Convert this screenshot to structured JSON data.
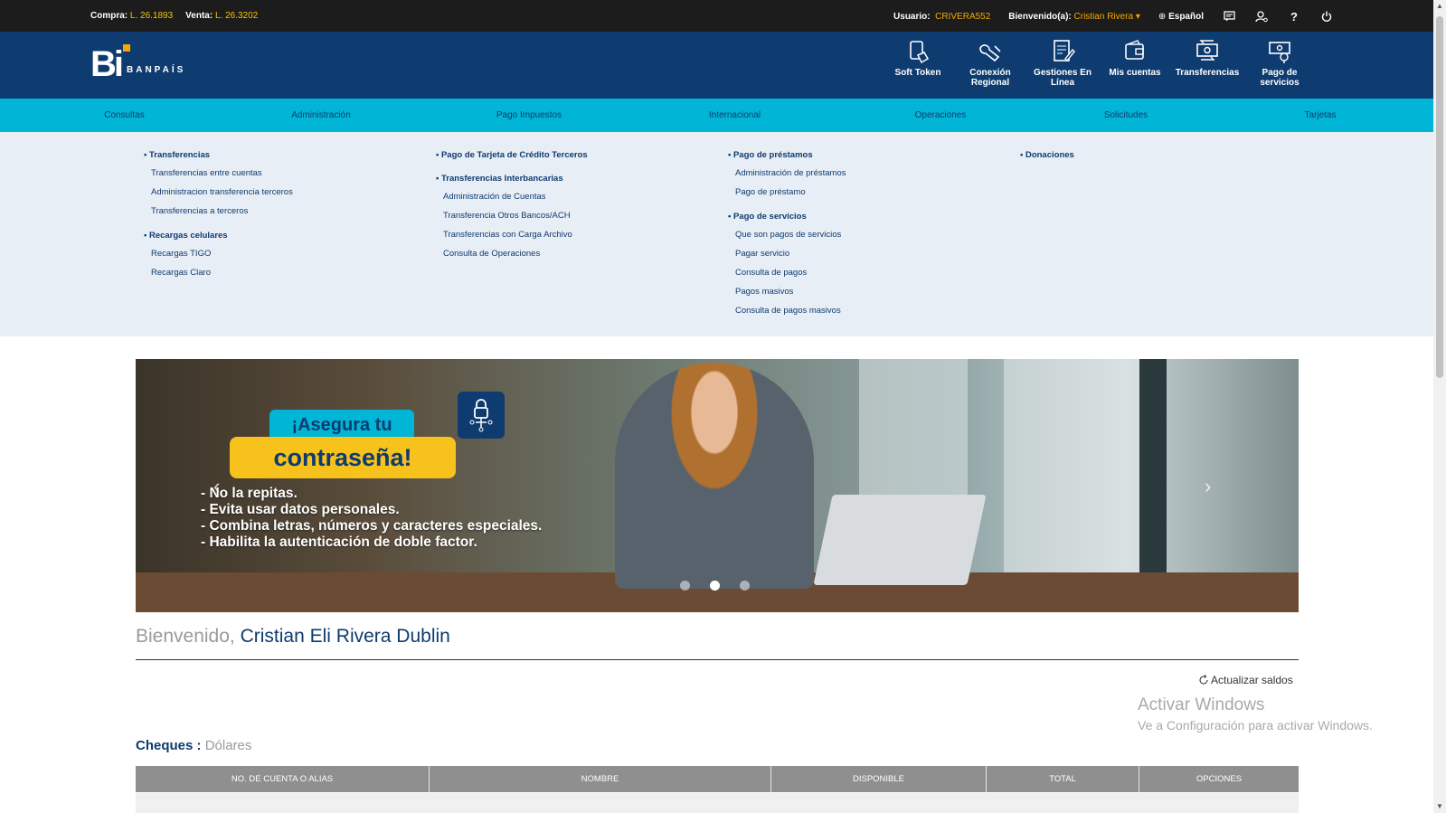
{
  "topbar": {
    "compra_label": "Compra:",
    "compra_value": "L. 26.1893",
    "venta_label": "Venta:",
    "venta_value": "L. 26.3202",
    "usuario_label": "Usuario:",
    "usuario_value": "CRIVERA552",
    "bienvenido_label": "Bienvenido(a):",
    "bienvenido_value": "Cristian Rivera",
    "language": "Español"
  },
  "brand": {
    "logo_text": "Bi",
    "name": "BANPAÍS",
    "accent": "#f5a800"
  },
  "quick_links": [
    {
      "label": "Soft Token",
      "icon": "phone-touch-icon"
    },
    {
      "label": "Conexión Regional",
      "icon": "hand-link-icon"
    },
    {
      "label": "Gestiones En Línea",
      "icon": "document-edit-icon"
    },
    {
      "label": "Mis cuentas",
      "icon": "wallet-icon"
    },
    {
      "label": "Transferencias",
      "icon": "money-transfer-icon"
    },
    {
      "label": "Pago de servicios",
      "icon": "bill-pay-icon"
    }
  ],
  "nav": [
    "Consultas",
    "Administración",
    "Pago Impuestos",
    "Internacional",
    "Operaciones",
    "Solicitudes",
    "Tarjetas"
  ],
  "nav_active": "Operaciones",
  "menu": {
    "col1": {
      "h1": "Transferencias",
      "h1_items": [
        "Transferencias entre cuentas",
        "Administracion transferencia terceros",
        "Transferencias a terceros"
      ],
      "h2": "Recargas celulares",
      "h2_items": [
        "Recargas TIGO",
        "Recargas Claro"
      ]
    },
    "col2": {
      "h1": "Pago de Tarjeta de Crédito Terceros",
      "h2": "Transferencias Interbancarias",
      "h2_items": [
        "Administración de Cuentas",
        "Transferencia Otros Bancos/ACH",
        "Transferencias con Carga Archivo",
        "Consulta de Operaciones"
      ]
    },
    "col3": {
      "h1": "Pago de préstamos",
      "h1_items": [
        "Administración de préstamos",
        "Pago de préstamo"
      ],
      "h2": "Pago de servicios",
      "h2_items": [
        "Que son pagos de servicios",
        "Pagar servicio",
        "Consulta de pagos",
        "Pagos masivos",
        "Consulta de pagos masivos"
      ]
    },
    "col4": {
      "h1": "Donaciones"
    }
  },
  "banner": {
    "pill1": "¡Asegura tu",
    "pill2": "contraseña!",
    "tips": [
      "- No la repitas.",
      "- Evita usar datos personales.",
      "- Combina letras, números y caracteres especiales.",
      "- Habilita la autenticación de doble factor."
    ],
    "active_slide": 2,
    "slide_count": 3
  },
  "welcome": {
    "greeting": "Bienvenido,",
    "name": "Cristian Eli Rivera Dublin"
  },
  "refresh_label": "Actualizar saldos",
  "watermark": {
    "title": "Activar Windows",
    "subtitle": "Ve a Configuración para activar Windows."
  },
  "section": {
    "title": "Cheques :",
    "currency": "Dólares"
  },
  "table": {
    "headers": [
      "NO. DE CUENTA O ALIAS",
      "NOMBRE",
      "DISPONIBLE",
      "TOTAL",
      "OPCIONES"
    ]
  }
}
